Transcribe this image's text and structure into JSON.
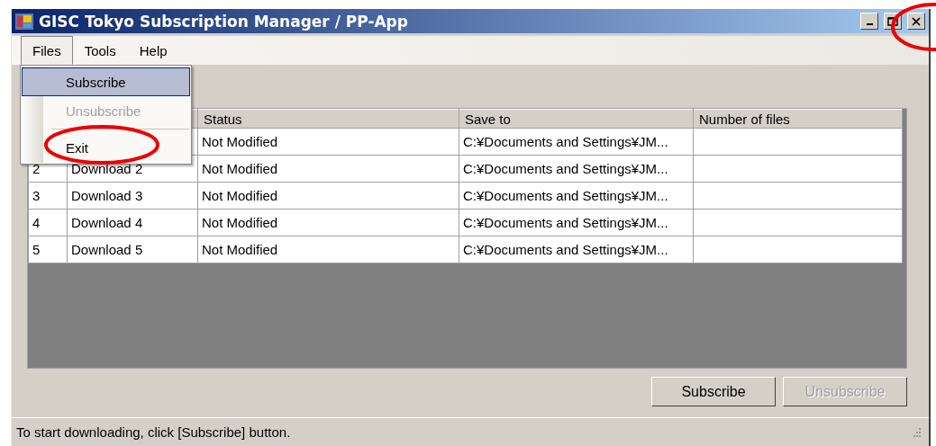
{
  "window": {
    "title": "GISC Tokyo Subscription Manager / PP-App"
  },
  "menubar": {
    "items": [
      {
        "label": "Files",
        "selected": true
      },
      {
        "label": "Tools",
        "selected": false
      },
      {
        "label": "Help",
        "selected": false
      }
    ]
  },
  "files_menu": {
    "items": [
      {
        "kind": "item",
        "label": "Subscribe",
        "selected": true,
        "disabled": false
      },
      {
        "kind": "item",
        "label": "Unsubscribe",
        "selected": false,
        "disabled": true
      },
      {
        "kind": "separator"
      },
      {
        "kind": "item",
        "label": "Exit",
        "selected": false,
        "disabled": false
      }
    ]
  },
  "table": {
    "columns": [
      "Status",
      "Save to",
      "Number of files"
    ],
    "rows": [
      {
        "status": "Not Modified",
        "save_to": "C:¥Documents and Settings¥JM..."
      },
      {
        "number": "2",
        "name": "Download 2",
        "status": "Not Modified",
        "save_to": "C:¥Documents and Settings¥JM..."
      },
      {
        "number": "3",
        "name": "Download 3",
        "status": "Not Modified",
        "save_to": "C:¥Documents and Settings¥JM..."
      },
      {
        "number": "4",
        "name": "Download 4",
        "status": "Not Modified",
        "save_to": "C:¥Documents and Settings¥JM..."
      },
      {
        "number": "5",
        "name": "Download 5",
        "status": "Not Modified",
        "save_to": "C:¥Documents and Settings¥JM..."
      }
    ]
  },
  "buttons": [
    {
      "label": "Subscribe",
      "disabled": false
    },
    {
      "label": "Unsubscribe",
      "disabled": true
    }
  ],
  "status_bar": "To start downloading, click [Subscribe] button."
}
